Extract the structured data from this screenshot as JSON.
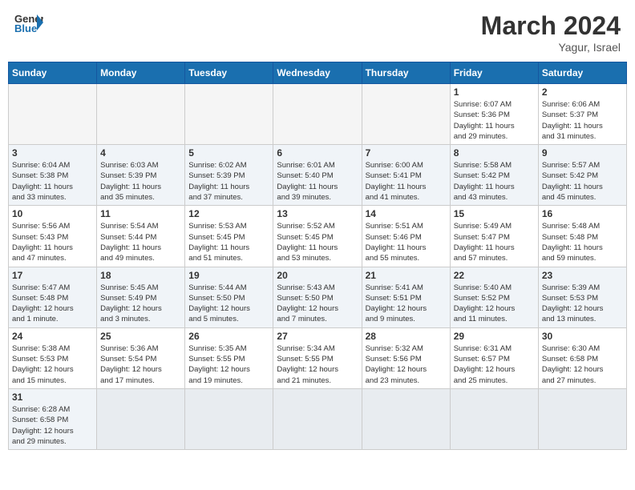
{
  "header": {
    "logo_general": "General",
    "logo_blue": "Blue",
    "month_title": "March 2024",
    "location": "Yagur, Israel"
  },
  "days_of_week": [
    "Sunday",
    "Monday",
    "Tuesday",
    "Wednesday",
    "Thursday",
    "Friday",
    "Saturday"
  ],
  "weeks": [
    {
      "days": [
        {
          "number": "",
          "info": "",
          "empty": true
        },
        {
          "number": "",
          "info": "",
          "empty": true
        },
        {
          "number": "",
          "info": "",
          "empty": true
        },
        {
          "number": "",
          "info": "",
          "empty": true
        },
        {
          "number": "",
          "info": "",
          "empty": true
        },
        {
          "number": "1",
          "info": "Sunrise: 6:07 AM\nSunset: 5:36 PM\nDaylight: 11 hours\nand 29 minutes.",
          "empty": false
        },
        {
          "number": "2",
          "info": "Sunrise: 6:06 AM\nSunset: 5:37 PM\nDaylight: 11 hours\nand 31 minutes.",
          "empty": false
        }
      ]
    },
    {
      "days": [
        {
          "number": "3",
          "info": "Sunrise: 6:04 AM\nSunset: 5:38 PM\nDaylight: 11 hours\nand 33 minutes.",
          "empty": false
        },
        {
          "number": "4",
          "info": "Sunrise: 6:03 AM\nSunset: 5:39 PM\nDaylight: 11 hours\nand 35 minutes.",
          "empty": false
        },
        {
          "number": "5",
          "info": "Sunrise: 6:02 AM\nSunset: 5:39 PM\nDaylight: 11 hours\nand 37 minutes.",
          "empty": false
        },
        {
          "number": "6",
          "info": "Sunrise: 6:01 AM\nSunset: 5:40 PM\nDaylight: 11 hours\nand 39 minutes.",
          "empty": false
        },
        {
          "number": "7",
          "info": "Sunrise: 6:00 AM\nSunset: 5:41 PM\nDaylight: 11 hours\nand 41 minutes.",
          "empty": false
        },
        {
          "number": "8",
          "info": "Sunrise: 5:58 AM\nSunset: 5:42 PM\nDaylight: 11 hours\nand 43 minutes.",
          "empty": false
        },
        {
          "number": "9",
          "info": "Sunrise: 5:57 AM\nSunset: 5:42 PM\nDaylight: 11 hours\nand 45 minutes.",
          "empty": false
        }
      ]
    },
    {
      "days": [
        {
          "number": "10",
          "info": "Sunrise: 5:56 AM\nSunset: 5:43 PM\nDaylight: 11 hours\nand 47 minutes.",
          "empty": false
        },
        {
          "number": "11",
          "info": "Sunrise: 5:54 AM\nSunset: 5:44 PM\nDaylight: 11 hours\nand 49 minutes.",
          "empty": false
        },
        {
          "number": "12",
          "info": "Sunrise: 5:53 AM\nSunset: 5:45 PM\nDaylight: 11 hours\nand 51 minutes.",
          "empty": false
        },
        {
          "number": "13",
          "info": "Sunrise: 5:52 AM\nSunset: 5:45 PM\nDaylight: 11 hours\nand 53 minutes.",
          "empty": false
        },
        {
          "number": "14",
          "info": "Sunrise: 5:51 AM\nSunset: 5:46 PM\nDaylight: 11 hours\nand 55 minutes.",
          "empty": false
        },
        {
          "number": "15",
          "info": "Sunrise: 5:49 AM\nSunset: 5:47 PM\nDaylight: 11 hours\nand 57 minutes.",
          "empty": false
        },
        {
          "number": "16",
          "info": "Sunrise: 5:48 AM\nSunset: 5:48 PM\nDaylight: 11 hours\nand 59 minutes.",
          "empty": false
        }
      ]
    },
    {
      "days": [
        {
          "number": "17",
          "info": "Sunrise: 5:47 AM\nSunset: 5:48 PM\nDaylight: 12 hours\nand 1 minute.",
          "empty": false
        },
        {
          "number": "18",
          "info": "Sunrise: 5:45 AM\nSunset: 5:49 PM\nDaylight: 12 hours\nand 3 minutes.",
          "empty": false
        },
        {
          "number": "19",
          "info": "Sunrise: 5:44 AM\nSunset: 5:50 PM\nDaylight: 12 hours\nand 5 minutes.",
          "empty": false
        },
        {
          "number": "20",
          "info": "Sunrise: 5:43 AM\nSunset: 5:50 PM\nDaylight: 12 hours\nand 7 minutes.",
          "empty": false
        },
        {
          "number": "21",
          "info": "Sunrise: 5:41 AM\nSunset: 5:51 PM\nDaylight: 12 hours\nand 9 minutes.",
          "empty": false
        },
        {
          "number": "22",
          "info": "Sunrise: 5:40 AM\nSunset: 5:52 PM\nDaylight: 12 hours\nand 11 minutes.",
          "empty": false
        },
        {
          "number": "23",
          "info": "Sunrise: 5:39 AM\nSunset: 5:53 PM\nDaylight: 12 hours\nand 13 minutes.",
          "empty": false
        }
      ]
    },
    {
      "days": [
        {
          "number": "24",
          "info": "Sunrise: 5:38 AM\nSunset: 5:53 PM\nDaylight: 12 hours\nand 15 minutes.",
          "empty": false
        },
        {
          "number": "25",
          "info": "Sunrise: 5:36 AM\nSunset: 5:54 PM\nDaylight: 12 hours\nand 17 minutes.",
          "empty": false
        },
        {
          "number": "26",
          "info": "Sunrise: 5:35 AM\nSunset: 5:55 PM\nDaylight: 12 hours\nand 19 minutes.",
          "empty": false
        },
        {
          "number": "27",
          "info": "Sunrise: 5:34 AM\nSunset: 5:55 PM\nDaylight: 12 hours\nand 21 minutes.",
          "empty": false
        },
        {
          "number": "28",
          "info": "Sunrise: 5:32 AM\nSunset: 5:56 PM\nDaylight: 12 hours\nand 23 minutes.",
          "empty": false
        },
        {
          "number": "29",
          "info": "Sunrise: 6:31 AM\nSunset: 6:57 PM\nDaylight: 12 hours\nand 25 minutes.",
          "empty": false
        },
        {
          "number": "30",
          "info": "Sunrise: 6:30 AM\nSunset: 6:58 PM\nDaylight: 12 hours\nand 27 minutes.",
          "empty": false
        }
      ]
    },
    {
      "days": [
        {
          "number": "31",
          "info": "Sunrise: 6:28 AM\nSunset: 6:58 PM\nDaylight: 12 hours\nand 29 minutes.",
          "empty": false
        },
        {
          "number": "",
          "info": "",
          "empty": true
        },
        {
          "number": "",
          "info": "",
          "empty": true
        },
        {
          "number": "",
          "info": "",
          "empty": true
        },
        {
          "number": "",
          "info": "",
          "empty": true
        },
        {
          "number": "",
          "info": "",
          "empty": true
        },
        {
          "number": "",
          "info": "",
          "empty": true
        }
      ]
    }
  ]
}
